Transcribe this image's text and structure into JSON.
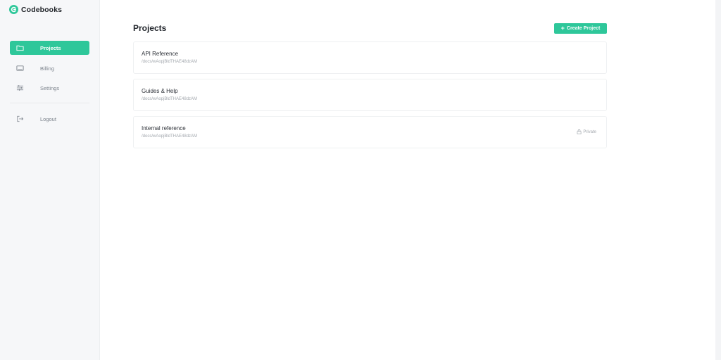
{
  "brand": {
    "name": "Codebooks"
  },
  "colors": {
    "accent": "#2ec79a"
  },
  "sidebar": {
    "items": [
      {
        "label": "Projects",
        "icon": "folder-icon",
        "active": true
      },
      {
        "label": "Billing",
        "icon": "monitor-icon",
        "active": false
      },
      {
        "label": "Settings",
        "icon": "sliders-icon",
        "active": false
      },
      {
        "label": "Logout",
        "icon": "logout-icon",
        "active": false
      }
    ]
  },
  "main": {
    "title": "Projects",
    "create_button": {
      "label": "Create Project",
      "icon": "plus-icon"
    },
    "projects": [
      {
        "name": "API Reference",
        "path": "/docs/wAopjBldTHAE48dzAM",
        "badge": ""
      },
      {
        "name": "Guides & Help",
        "path": "/docs/wAopjBldTHAE48dzAM",
        "badge": ""
      },
      {
        "name": "Internal reference",
        "path": "/docs/wAopjBldTHAE48dzAM",
        "badge": "Private",
        "badge_icon": "lock-icon"
      }
    ]
  }
}
